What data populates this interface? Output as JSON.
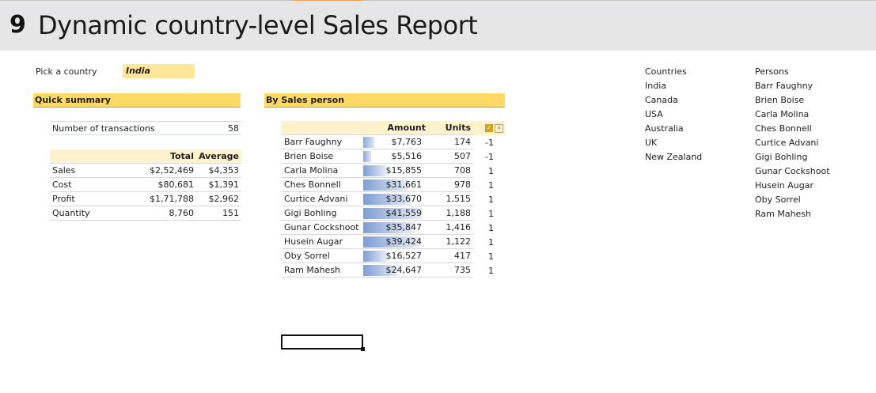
{
  "header": {
    "number": "9",
    "title": "Dynamic country-level Sales Report"
  },
  "picker": {
    "label": "Pick a country",
    "value": "India"
  },
  "quick_summary": {
    "title": "Quick summary",
    "transactions_label": "Number of transactions",
    "transactions_value": "58",
    "columns": [
      "Total",
      "Average"
    ],
    "rows": [
      {
        "label": "Sales",
        "total": "$2,52,469",
        "average": "$4,353"
      },
      {
        "label": "Cost",
        "total": "$80,681",
        "average": "$1,391"
      },
      {
        "label": "Profit",
        "total": "$1,71,788",
        "average": "$2,962"
      },
      {
        "label": "Quantity",
        "total": "8,760",
        "average": "151"
      }
    ]
  },
  "by_sales_person": {
    "title": "By Sales person",
    "columns": [
      "Amount",
      "Units"
    ],
    "rows": [
      {
        "name": "Barr Faughny",
        "amount": "$7,763",
        "units": "174",
        "flag": "-1",
        "bar_fraction": 0.19
      },
      {
        "name": "Brien Boise",
        "amount": "$5,516",
        "units": "507",
        "flag": "-1",
        "bar_fraction": 0.13
      },
      {
        "name": "Carla Molina",
        "amount": "$15,855",
        "units": "708",
        "flag": "1",
        "bar_fraction": 0.38
      },
      {
        "name": "Ches Bonnell",
        "amount": "$31,661",
        "units": "978",
        "flag": "1",
        "bar_fraction": 0.76
      },
      {
        "name": "Curtice Advani",
        "amount": "$33,670",
        "units": "1,515",
        "flag": "1",
        "bar_fraction": 0.81
      },
      {
        "name": "Gigi Bohling",
        "amount": "$41,559",
        "units": "1,188",
        "flag": "1",
        "bar_fraction": 1.0
      },
      {
        "name": "Gunar Cockshoot",
        "amount": "$35,847",
        "units": "1,416",
        "flag": "1",
        "bar_fraction": 0.86
      },
      {
        "name": "Husein Augar",
        "amount": "$39,424",
        "units": "1,122",
        "flag": "1",
        "bar_fraction": 0.95
      },
      {
        "name": "Oby Sorrel",
        "amount": "$16,527",
        "units": "417",
        "flag": "1",
        "bar_fraction": 0.4
      },
      {
        "name": "Ram Mahesh",
        "amount": "$24,647",
        "units": "735",
        "flag": "1",
        "bar_fraction": 0.59
      }
    ]
  },
  "countries": {
    "header": "Countries",
    "items": [
      "India",
      "Canada",
      "USA",
      "Australia",
      "UK",
      "New Zealand"
    ]
  },
  "persons": {
    "header": "Persons",
    "items": [
      "Barr Faughny",
      "Brien Boise",
      "Carla Molina",
      "Ches Bonnell",
      "Curtice Advani",
      "Gigi Bohling",
      "Gunar Cockshoot",
      "Husein Augar",
      "Oby Sorrel",
      "Ram Mahesh"
    ]
  },
  "colors": {
    "section_header": "#ffd966",
    "table_header": "#fff2cc",
    "picker_fill": "#ffe699",
    "databar": "#7f9ed4"
  }
}
